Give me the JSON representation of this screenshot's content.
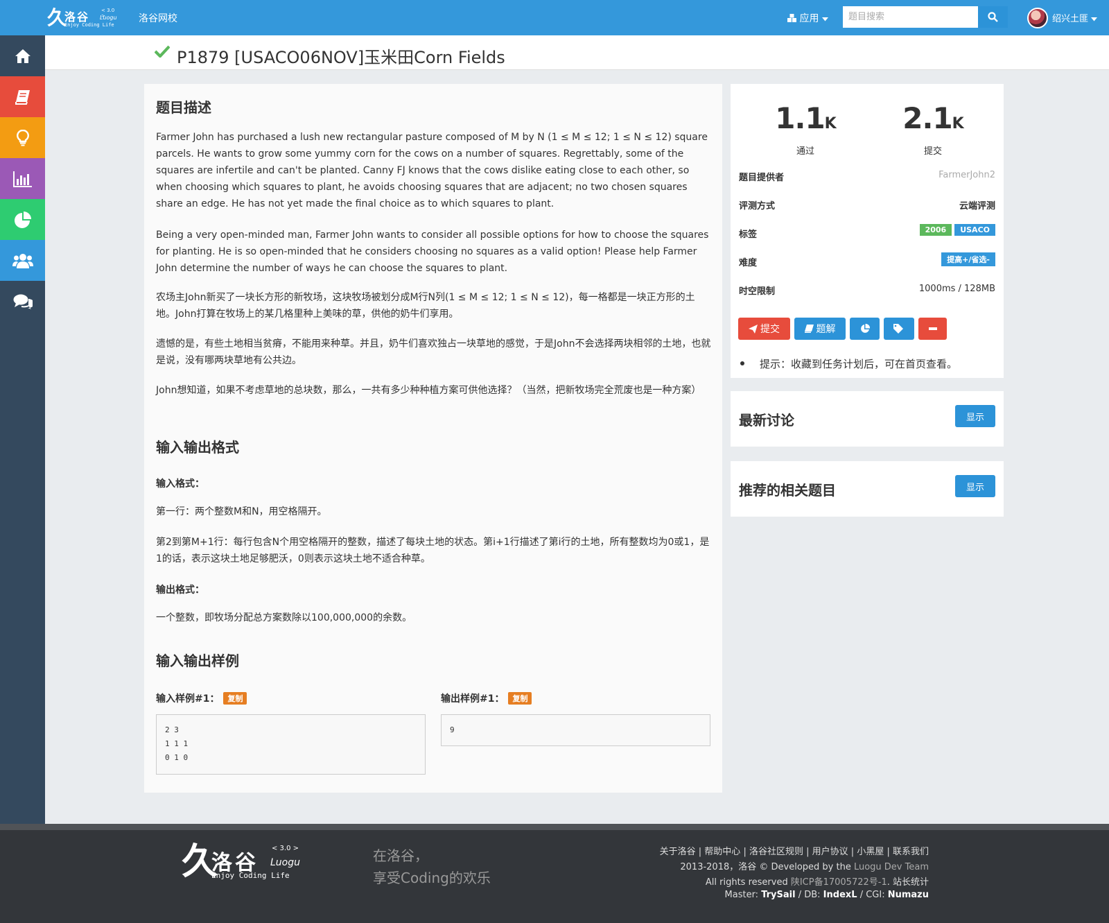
{
  "header": {
    "logo": {
      "mark": "久",
      "name": "洛谷",
      "version": "< 3.0 >",
      "italic": "Luogu",
      "tagline": "Enjoy Coding Life"
    },
    "school_link": "洛谷网校",
    "apps_menu": "应用",
    "search_placeholder": "题目搜索",
    "username": "绍兴土匪"
  },
  "sidebar": {
    "items": [
      {
        "icon": "home-icon",
        "color": "#34495e"
      },
      {
        "icon": "book-icon",
        "color": "#e74c3c"
      },
      {
        "icon": "lightbulb-icon",
        "color": "#f39c12"
      },
      {
        "icon": "bar-chart-icon",
        "color": "#9b59b6"
      },
      {
        "icon": "pie-chart-icon",
        "color": "#2ecc71"
      },
      {
        "icon": "users-icon",
        "color": "#3498db"
      },
      {
        "icon": "comments-icon",
        "color": "#34495e"
      }
    ]
  },
  "problem": {
    "title": "P1879 [USACO06NOV]玉米田Corn Fields",
    "status_color": "#5cb85c"
  },
  "content": {
    "desc_heading": "题目描述",
    "desc_en_1": "Farmer John has purchased a lush new rectangular pasture composed of M by N (1 ≤ M ≤ 12; 1 ≤ N ≤ 12) square parcels. He wants to grow some yummy corn for the cows on a number of squares. Regrettably, some of the squares are infertile and can't be planted. Canny FJ knows that the cows dislike eating close to each other, so when choosing which squares to plant, he avoids choosing squares that are adjacent; no two chosen squares share an edge. He has not yet made the final choice as to which squares to plant.",
    "desc_en_2": "Being a very open-minded man, Farmer John wants to consider all possible options for how to choose the squares for planting. He is so open-minded that he considers choosing no squares as a valid option! Please help Farmer John determine the number of ways he can choose the squares to plant.",
    "desc_cn_1": "农场主John新买了一块长方形的新牧场，这块牧场被划分成M行N列(1 ≤ M ≤ 12; 1 ≤ N ≤ 12)，每一格都是一块正方形的土地。John打算在牧场上的某几格里种上美味的草，供他的奶牛们享用。",
    "desc_cn_2": "遗憾的是，有些土地相当贫瘠，不能用来种草。并且，奶牛们喜欢独占一块草地的感觉，于是John不会选择两块相邻的土地，也就是说，没有哪两块草地有公共边。",
    "desc_cn_3": "John想知道，如果不考虑草地的总块数，那么，一共有多少种种植方案可供他选择？（当然，把新牧场完全荒废也是一种方案）",
    "io_heading": "输入输出格式",
    "input_label": "输入格式：",
    "input_1": "第一行：两个整数M和N，用空格隔开。",
    "input_2": "第2到第M+1行：每行包含N个用空格隔开的整数，描述了每块土地的状态。第i+1行描述了第i行的土地，所有整数均为0或1，是1的话，表示这块土地足够肥沃，0则表示这块土地不适合种草。",
    "output_label": "输出格式：",
    "output_1": "一个整数，即牧场分配总方案数除以100,000,000的余数。",
    "sample_heading": "输入输出样例",
    "sample_in_label": "输入样例#1：",
    "sample_out_label": "输出样例#1：",
    "copy_label": "复制",
    "sample_in": "2 3\n1 1 1\n0 1 0",
    "sample_out": "9"
  },
  "info": {
    "passed_num": "1.1",
    "passed_unit": "K",
    "passed_label": "通过",
    "submit_num": "2.1",
    "submit_unit": "K",
    "submit_label": "提交",
    "provider_key": "题目提供者",
    "provider_val": "FarmerJohn2",
    "judge_key": "评测方式",
    "judge_val": "云端评测",
    "tags_key": "标签",
    "tags": [
      {
        "label": "2006",
        "color": "#5cb85c"
      },
      {
        "label": "USACO",
        "color": "#3498db"
      }
    ],
    "difficulty_key": "难度",
    "difficulty_val": "提高+/省选-",
    "difficulty_color": "#3498db",
    "limit_key": "时空限制",
    "limit_val": "1000ms / 128MB",
    "submit_btn": "提交",
    "solution_btn": "题解",
    "hint": "提示：收藏到任务计划后，可在首页查看。"
  },
  "discuss": {
    "heading": "最新讨论",
    "button": "显示"
  },
  "related": {
    "heading": "推荐的相关题目",
    "button": "显示"
  },
  "footer": {
    "logo": {
      "mark": "久",
      "name": "洛谷",
      "version": "< 3.0 >",
      "italic": "Luogu",
      "tagline": "Enjoy Coding Life"
    },
    "slogan_1": "在洛谷，",
    "slogan_2": "享受Coding的欢乐",
    "links": [
      "关于洛谷",
      "帮助中心",
      "洛谷社区规则",
      "用户协议",
      "小黑屋",
      "联系我们"
    ],
    "copyright_a": "2013-2018，洛谷 © Developed by the ",
    "copyright_b": "Luogu Dev Team",
    "rights_a": "All rights reserved ",
    "rights_b": "陕ICP备17005722号-1",
    "rights_c": ". 站长统计",
    "server_master_lbl": "Master: ",
    "server_master": "TrySail",
    "server_db_lbl": " / DB: ",
    "server_db": "IndexL",
    "server_cgi_lbl": " / CGI: ",
    "server_cgi": "Numazu"
  }
}
